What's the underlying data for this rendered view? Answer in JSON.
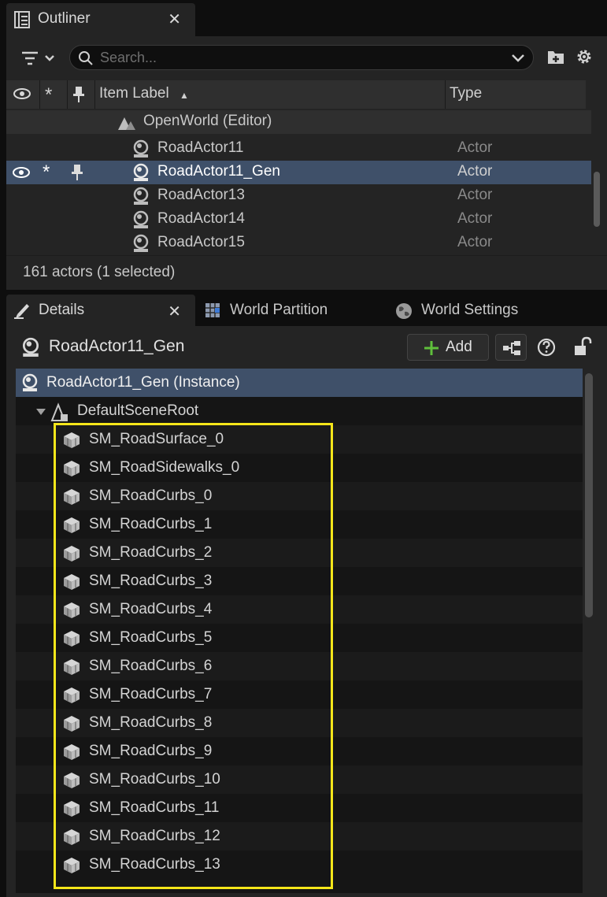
{
  "outliner": {
    "tab_label": "Outliner",
    "close": "✕",
    "search_placeholder": "Search...",
    "columns": {
      "item_label": "Item Label",
      "sort": "▲",
      "type": "Type",
      "visibility": "👁",
      "star": "*",
      "pin": "📌"
    },
    "world_row": "OpenWorld (Editor)",
    "rows": [
      {
        "label": "RoadActor11",
        "type": "Actor",
        "selected": false
      },
      {
        "label": "RoadActor11_Gen",
        "type": "Actor",
        "selected": true
      },
      {
        "label": "RoadActor13",
        "type": "Actor",
        "selected": false
      },
      {
        "label": "RoadActor14",
        "type": "Actor",
        "selected": false
      },
      {
        "label": "RoadActor15",
        "type": "Actor",
        "selected": false
      }
    ],
    "status": "161 actors (1 selected)"
  },
  "details": {
    "tabs": {
      "details": "Details",
      "close": "✕",
      "world_partition": "World Partition",
      "world_settings": "World Settings"
    },
    "actor_name": "RoadActor11_Gen",
    "add_label": "Add",
    "instance_row": "RoadActor11_Gen (Instance)",
    "root_row": "DefaultSceneRoot",
    "components": [
      "SM_RoadSurface_0",
      "SM_RoadSidewalks_0",
      "SM_RoadCurbs_0",
      "SM_RoadCurbs_1",
      "SM_RoadCurbs_2",
      "SM_RoadCurbs_3",
      "SM_RoadCurbs_4",
      "SM_RoadCurbs_5",
      "SM_RoadCurbs_6",
      "SM_RoadCurbs_7",
      "SM_RoadCurbs_8",
      "SM_RoadCurbs_9",
      "SM_RoadCurbs_10",
      "SM_RoadCurbs_11",
      "SM_RoadCurbs_12",
      "SM_RoadCurbs_13"
    ]
  },
  "colors": {
    "selected_row": "#3f5069",
    "highlight_box": "#f5e61a",
    "add_plus": "#5fbf3b",
    "panel": "#242424"
  }
}
